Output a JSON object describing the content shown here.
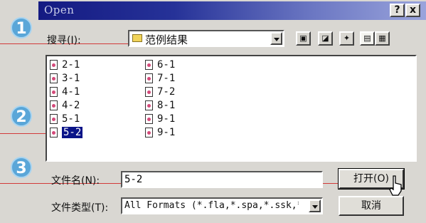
{
  "window": {
    "title": "Open",
    "help_label": "?",
    "close_label": "x"
  },
  "markers": [
    "1",
    "2",
    "3"
  ],
  "lookin": {
    "label": "搜寻(I):",
    "folder": "范例结果"
  },
  "files": [
    {
      "name": "2-1"
    },
    {
      "name": "3-1"
    },
    {
      "name": "4-1"
    },
    {
      "name": "4-2"
    },
    {
      "name": "5-1"
    },
    {
      "name": "5-2",
      "selected": true
    },
    {
      "name": "6-1"
    },
    {
      "name": "7-1"
    },
    {
      "name": "7-2"
    },
    {
      "name": "8-1"
    },
    {
      "name": "9-1"
    },
    {
      "name": "9-1"
    }
  ],
  "filename": {
    "label": "文件名(N):",
    "value": "5-2"
  },
  "filetype": {
    "label": "文件类型(T):",
    "value": "All Formats (*.fla,*.spa,*.ssk,*.s"
  },
  "buttons": {
    "open": "打开(O)",
    "cancel": "取消"
  },
  "colors": {
    "titlebar_start": "#141a82",
    "selection": "#0a1488",
    "marker": "#5aa6d8",
    "pointer_line": "#d23a3a"
  }
}
